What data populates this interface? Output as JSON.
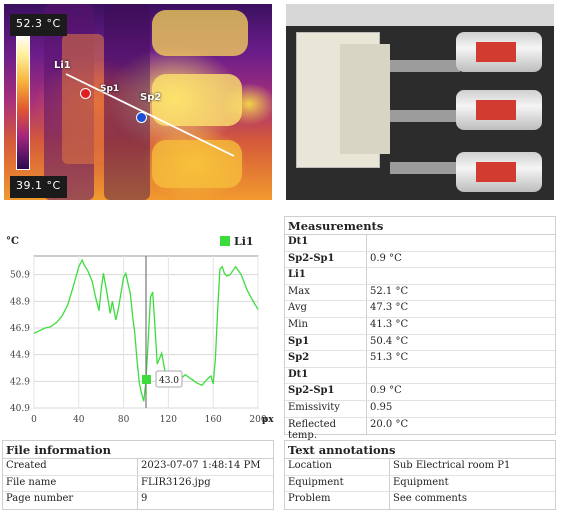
{
  "thermal": {
    "max_temp": "52.3 °C",
    "min_temp": "39.1 °C",
    "labels": {
      "line": "Li1",
      "spot1": "Sp1",
      "spot2": "Sp2"
    },
    "colors": {
      "spot1": "#e02020",
      "spot2": "#1a4fd6",
      "line": "#ffffff"
    }
  },
  "chart_data": {
    "type": "line",
    "ylabel": "°C",
    "xlabel": "px",
    "x_ticks": [
      "0",
      "40",
      "80",
      "120",
      "160",
      "200"
    ],
    "y_ticks": [
      "40.9",
      "42.9",
      "44.9",
      "46.9",
      "48.9",
      "50.9"
    ],
    "xlim": [
      0,
      200
    ],
    "ylim": [
      40.9,
      52.3
    ],
    "grid": true,
    "legend": "top-right",
    "series": [
      {
        "name": "Li1",
        "color": "#3ddc3d",
        "x": [
          0,
          5,
          10,
          15,
          20,
          25,
          30,
          35,
          40,
          43,
          45,
          48,
          52,
          55,
          58,
          60,
          62,
          65,
          68,
          70,
          73,
          75,
          78,
          80,
          82,
          84,
          86,
          88,
          90,
          92,
          94,
          96,
          98,
          100,
          102,
          104,
          106,
          108,
          110,
          112,
          114,
          116,
          118,
          120,
          125,
          130,
          135,
          140,
          145,
          150,
          155,
          158,
          160,
          162,
          164,
          166,
          168,
          170,
          172,
          175,
          180,
          185,
          190,
          195,
          200
        ],
        "y": [
          46.5,
          46.7,
          46.9,
          47.0,
          47.3,
          47.8,
          48.6,
          50.0,
          51.5,
          52.0,
          51.6,
          51.2,
          50.4,
          49.2,
          48.2,
          49.8,
          51.0,
          49.6,
          48.0,
          48.9,
          47.5,
          48.2,
          49.7,
          50.7,
          51.0,
          50.2,
          49.5,
          47.8,
          46.5,
          44.5,
          42.8,
          42.0,
          41.4,
          43.0,
          46.0,
          49.2,
          49.6,
          47.0,
          44.2,
          44.6,
          45.0,
          44.1,
          43.2,
          43.0,
          43.2,
          43.0,
          43.4,
          43.1,
          42.8,
          42.6,
          43.1,
          43.3,
          42.7,
          44.6,
          48.3,
          51.3,
          51.5,
          51.0,
          50.8,
          50.9,
          51.5,
          50.9,
          49.8,
          49.0,
          48.3
        ]
      }
    ],
    "annotation": {
      "x": 100,
      "y": 43.0,
      "label": "43.0"
    }
  },
  "measurements": {
    "title": "Measurements",
    "rows": [
      {
        "label": "Dt1",
        "value": "",
        "group": true
      },
      {
        "label": "Sp2-Sp1",
        "value": "0.9 °C",
        "group": true
      },
      {
        "label": "Li1",
        "value": "",
        "group": true
      },
      {
        "label": "Max",
        "value": "52.1 °C",
        "group": false
      },
      {
        "label": "Avg",
        "value": "47.3 °C",
        "group": false
      },
      {
        "label": "Min",
        "value": "41.3 °C",
        "group": false
      },
      {
        "label": "Sp1",
        "value": "50.4 °C",
        "group": true
      },
      {
        "label": "Sp2",
        "value": "51.3 °C",
        "group": true
      },
      {
        "label": "Dt1",
        "value": "",
        "group": true
      },
      {
        "label": "Sp2-Sp1",
        "value": "0.9 °C",
        "group": true
      },
      {
        "label": "Emissivity",
        "value": "0.95",
        "group": false
      },
      {
        "label": "Reflected temp.",
        "value": "20.0 °C",
        "group": false
      }
    ]
  },
  "file_info": {
    "title": "File information",
    "rows": [
      {
        "label": "Created",
        "value": "2023-07-07 1:48:14 PM"
      },
      {
        "label": "File name",
        "value": "FLIR3126.jpg"
      },
      {
        "label": "Page number",
        "value": "9"
      }
    ]
  },
  "text_annotations": {
    "title": "Text annotations",
    "rows": [
      {
        "label": "Location",
        "value": "Sub Electrical room P1"
      },
      {
        "label": "Equipment",
        "value": "Equipment"
      },
      {
        "label": "Problem",
        "value": "See comments"
      }
    ]
  }
}
